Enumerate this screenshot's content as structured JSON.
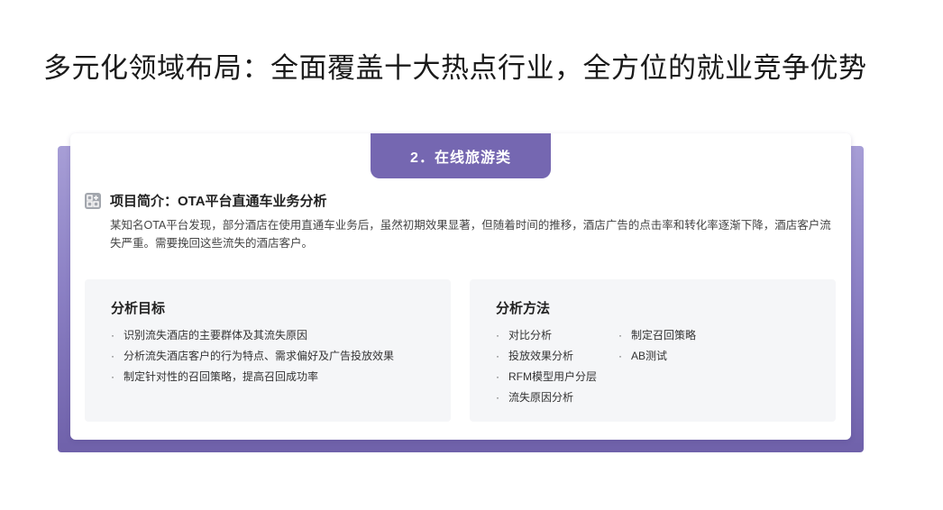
{
  "title": "多元化领域布局：全面覆盖十大热点行业，全方位的就业竞争优势",
  "card": {
    "tab_label": "2．在线旅游类",
    "intro": {
      "icon": "project-icon",
      "heading": "项目简介：OTA平台直通车业务分析",
      "text": "某知名OTA平台发现，部分酒店在使用直通车业务后，虽然初期效果显著，但随着时间的推移，酒店广告的点击率和转化率逐渐下降，酒店客户流失严重。需要挽回这些流失的酒店客户。"
    },
    "goals": {
      "heading": "分析目标",
      "bullet": "·",
      "items": [
        "识别流失酒店的主要群体及其流失原因",
        "分析流失酒店客户的行为特点、需求偏好及广告投放效果",
        "制定针对性的召回策略，提高召回成功率"
      ]
    },
    "methods": {
      "heading": "分析方法",
      "bullet": "·",
      "col1": [
        "对比分析",
        "投放效果分析",
        "RFM模型用户分层",
        "流失原因分析"
      ],
      "col2": [
        "制定召回策略",
        "AB测试"
      ]
    }
  },
  "colors": {
    "accent": "#7567b1",
    "frame_top": "#a79ed6",
    "frame_bottom": "#6f61aa",
    "panel_bg": "#f5f6f8"
  }
}
